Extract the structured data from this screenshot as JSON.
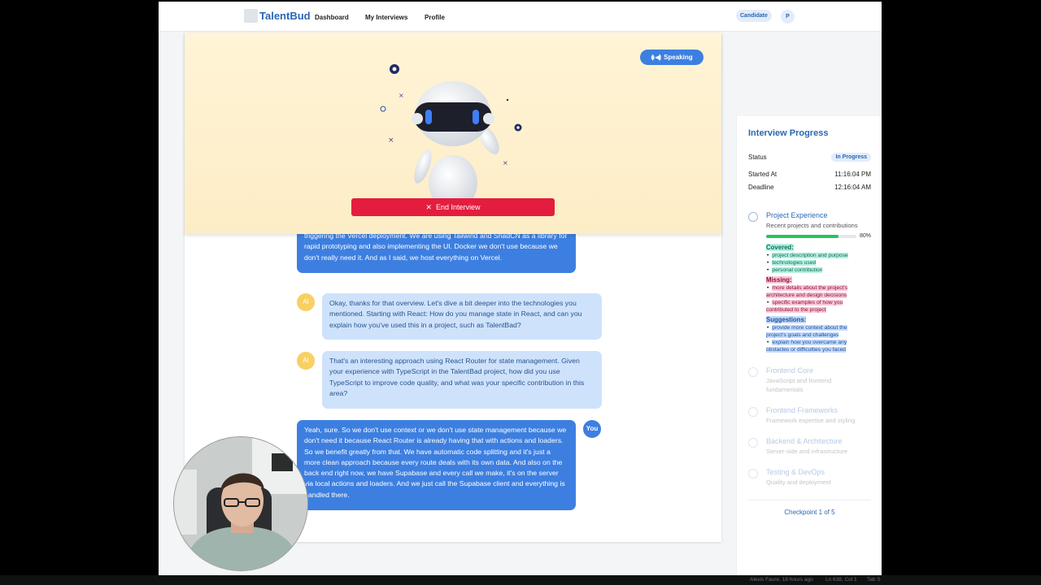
{
  "nav": {
    "brand": "TalentBud",
    "links": [
      "Dashboard",
      "My Interviews",
      "Profile"
    ],
    "role_badge": "Candidate",
    "avatar_initial": "P"
  },
  "hero": {
    "speaking_label": "Speaking",
    "end_button_label": "End Interview"
  },
  "chat": {
    "messages": [
      {
        "role": "user",
        "text": "triggering the Vercel deployment. We are using Tailwind and ShadCN as a library for rapid prototyping and also implementing the UI. Docker we don't use because we don't really need it. And as I said, we host everything on Vercel."
      },
      {
        "role": "ai",
        "avatar": "AI",
        "text": "Okay, thanks for that overview. Let's dive a bit deeper into the technologies you mentioned. Starting with React: How do you manage state in React, and can you explain how you've used this in a project, such as TalentBad?"
      },
      {
        "role": "ai",
        "avatar": "AI",
        "text": "That's an interesting approach using React Router for state management. Given your experience with TypeScript in the TalentBad project, how did you use TypeScript to improve code quality, and what was your specific contribution in this area?"
      },
      {
        "role": "user",
        "avatar": "You",
        "text": "Yeah, sure. So we don't use context or we don't use state management because we don't need it because React Router is already having that with actions and loaders. So we benefit greatly from that. We have automatic code splitting and it's just a more clean approach because every route deals with its own data. And also on the back end right now, we have Supabase and every call we make, it's on the server via local actions and loaders. And we just call the Supabase client and everything is handled there."
      }
    ]
  },
  "progress": {
    "title": "Interview Progress",
    "status_label": "Status",
    "status_value": "In Progress",
    "started_label": "Started At",
    "started_value": "11:16:04 PM",
    "deadline_label": "Deadline",
    "deadline_value": "12:16:04 AM",
    "checkpoints": [
      {
        "title": "Project Experience",
        "desc": "Recent projects and contributions",
        "progress": 80,
        "progress_label": "80%"
      },
      {
        "title": "Frontend Core",
        "desc": "JavaScript and frontend fundamentals"
      },
      {
        "title": "Frontend Frameworks",
        "desc": "Framework expertise and styling"
      },
      {
        "title": "Backend & Architecture",
        "desc": "Server-side and infrastructure"
      },
      {
        "title": "Testing & DevOps",
        "desc": "Quality and deployment"
      }
    ],
    "feedback": {
      "covered_label": "Covered:",
      "covered": [
        "project description and purpose",
        "technologies used",
        "personal contribution"
      ],
      "missing_label": "Missing:",
      "missing": [
        "more details about the project's architecture and design decisions",
        "specific examples of how you contributed to the project"
      ],
      "suggestions_label": "Suggestions:",
      "suggestions": [
        "provide more context about the project's goals and challenges",
        "explain how you overcame any obstacles or difficulties you faced"
      ]
    },
    "checkpoint_counter": "Checkpoint 1 of 5"
  },
  "statusbar": {
    "blame": "Alexis Faure, 18 hours ago",
    "position": "Ln 638, Col 1",
    "tab": "Tab S"
  },
  "colors": {
    "primary": "#3d7fe0",
    "brand_text": "#2b66b4",
    "end_button": "#e41d3e",
    "ai_bubble": "#cfe2fb",
    "ai_avatar": "#f8d062",
    "progress_fill": "#22c55e"
  }
}
